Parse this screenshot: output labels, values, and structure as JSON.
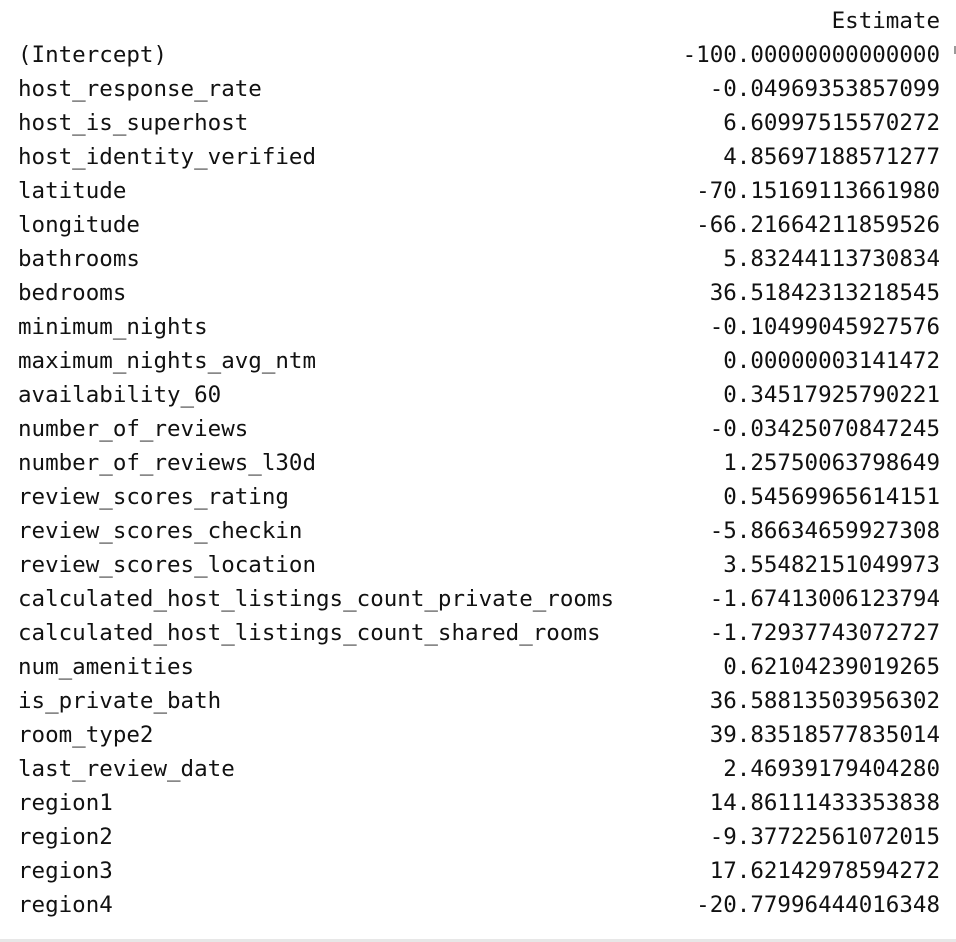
{
  "table": {
    "column_header": "Estimate",
    "rows": [
      {
        "name": "(Intercept)",
        "value": "-100.00000000000000"
      },
      {
        "name": "host_response_rate",
        "value": "-0.04969353857099"
      },
      {
        "name": "host_is_superhost",
        "value": "6.60997515570272"
      },
      {
        "name": "host_identity_verified",
        "value": "4.85697188571277"
      },
      {
        "name": "latitude",
        "value": "-70.15169113661980"
      },
      {
        "name": "longitude",
        "value": "-66.21664211859526"
      },
      {
        "name": "bathrooms",
        "value": "5.83244113730834"
      },
      {
        "name": "bedrooms",
        "value": "36.51842313218545"
      },
      {
        "name": "minimum_nights",
        "value": "-0.10499045927576"
      },
      {
        "name": "maximum_nights_avg_ntm",
        "value": "0.00000003141472"
      },
      {
        "name": "availability_60",
        "value": "0.34517925790221"
      },
      {
        "name": "number_of_reviews",
        "value": "-0.03425070847245"
      },
      {
        "name": "number_of_reviews_l30d",
        "value": "1.25750063798649"
      },
      {
        "name": "review_scores_rating",
        "value": "0.54569965614151"
      },
      {
        "name": "review_scores_checkin",
        "value": "-5.86634659927308"
      },
      {
        "name": "review_scores_location",
        "value": "3.55482151049973"
      },
      {
        "name": "calculated_host_listings_count_private_rooms",
        "value": "-1.67413006123794"
      },
      {
        "name": "calculated_host_listings_count_shared_rooms",
        "value": "-1.72937743072727"
      },
      {
        "name": "num_amenities",
        "value": "0.62104239019265"
      },
      {
        "name": "is_private_bath",
        "value": "36.58813503956302"
      },
      {
        "name": "room_type2",
        "value": "39.83518577835014"
      },
      {
        "name": "last_review_date",
        "value": "2.46939179404280"
      },
      {
        "name": "region1",
        "value": "14.86111433353838"
      },
      {
        "name": "region2",
        "value": "-9.37722561072015"
      },
      {
        "name": "region3",
        "value": "17.62142978594272"
      },
      {
        "name": "region4",
        "value": "-20.77996444016348"
      }
    ]
  }
}
